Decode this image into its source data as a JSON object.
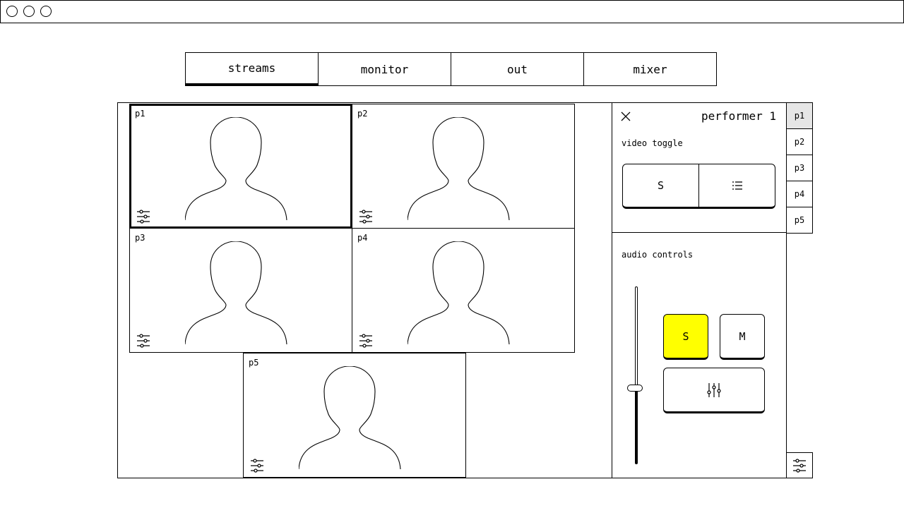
{
  "tabs": [
    {
      "label": "streams",
      "active": true
    },
    {
      "label": "monitor",
      "active": false
    },
    {
      "label": "out",
      "active": false
    },
    {
      "label": "mixer",
      "active": false
    }
  ],
  "streams": [
    {
      "label": "p1",
      "selected": true
    },
    {
      "label": "p2",
      "selected": false
    },
    {
      "label": "p3",
      "selected": false
    },
    {
      "label": "p4",
      "selected": false
    },
    {
      "label": "p5",
      "selected": false
    }
  ],
  "panel": {
    "title": "performer 1",
    "video_toggle_label": "video toggle",
    "video_solo_label": "S",
    "audio_controls_label": "audio controls",
    "solo_label": "S",
    "mute_label": "M",
    "solo_active": true,
    "solo_color": "#ffff00",
    "fader_level": 0.43
  },
  "selector": [
    {
      "label": "p1",
      "active": true
    },
    {
      "label": "p2",
      "active": false
    },
    {
      "label": "p3",
      "active": false
    },
    {
      "label": "p4",
      "active": false
    },
    {
      "label": "p5",
      "active": false
    }
  ],
  "icons": {
    "close": "close-icon",
    "list": "list-icon",
    "mixer": "sliders-icon",
    "settings": "settings-sliders-icon",
    "avatar": "person-silhouette-icon"
  }
}
